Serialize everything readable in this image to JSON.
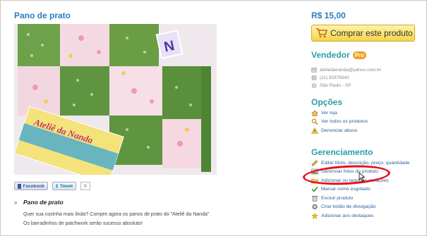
{
  "product": {
    "title": "Pano de prato",
    "price": "R$ 15,00",
    "buy_label": "Comprar este produto",
    "photo_text": "Ateliê da Nanda"
  },
  "vendor": {
    "heading": "Vendedor",
    "badge": "Pro",
    "email": "ateliedananda@yahoo.com.br",
    "phone": "(11) 92876942",
    "location": "São Paulo - SP"
  },
  "options": {
    "heading": "Opções",
    "items": [
      {
        "label": "Ver loja",
        "icon": "house-icon"
      },
      {
        "label": "Ver todos os produtos",
        "icon": "magnifier-icon"
      },
      {
        "label": "Denunciar abuso",
        "icon": "warning-icon"
      }
    ]
  },
  "management": {
    "heading": "Gerenciamento",
    "items": [
      {
        "label": "Editar título, descrição, preço, quantidade",
        "icon": "pencil-icon"
      },
      {
        "label": "Gerenciar fotos do produto",
        "icon": "photo-icon"
      },
      {
        "label": "Adicionar ou remover variações",
        "icon": "folder-icon"
      },
      {
        "label": "Marcar como esgotado",
        "icon": "check-icon"
      },
      {
        "label": "Excluir produto",
        "icon": "trash-icon"
      },
      {
        "label": "Criar botão de divulgação",
        "icon": "gear-icon"
      },
      {
        "label": "Adicionar aos destaques",
        "icon": "star-icon"
      }
    ]
  },
  "share": {
    "facebook": "Facebook",
    "tweet": "Tweet",
    "tweet_count": "0"
  },
  "description": {
    "bullet": "»",
    "title": "Pano de prato",
    "line1": "Quer sua cozinha mais linda? Compre agora os panos de prato do \"Ateliê da Nanda\"",
    "line2": "Os barradinhos de patchwork serão sucesso absoluto!"
  },
  "colors": {
    "accent": "#2a7bc4",
    "section": "#2a9ea6",
    "highlight": "#e3141c",
    "buy_button": "#f5d54a"
  }
}
